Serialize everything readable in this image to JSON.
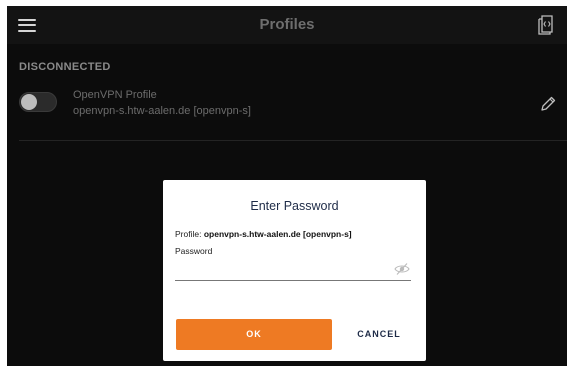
{
  "topbar": {
    "title": "Profiles",
    "menu_icon": "hamburger-menu-icon",
    "log_icon": "log-file-icon"
  },
  "section": {
    "header": "DISCONNECTED"
  },
  "profile": {
    "name": "OpenVPN Profile",
    "host": "openvpn-s.htw-aalen.de [openvpn-s]",
    "connected": false,
    "edit_icon": "pencil-icon"
  },
  "dialog": {
    "title": "Enter Password",
    "profile_label": "Profile: ",
    "profile_value": "openvpn-s.htw-aalen.de [openvpn-s]",
    "password_label": "Password",
    "password_value": "",
    "eye_icon": "eye-slash-icon",
    "ok_label": "OK",
    "cancel_label": "CANCEL"
  },
  "colors": {
    "accent": "#ee7a23",
    "background": "#0c0c0c",
    "topbar": "#131313",
    "dialog_text": "#1e2b47"
  }
}
